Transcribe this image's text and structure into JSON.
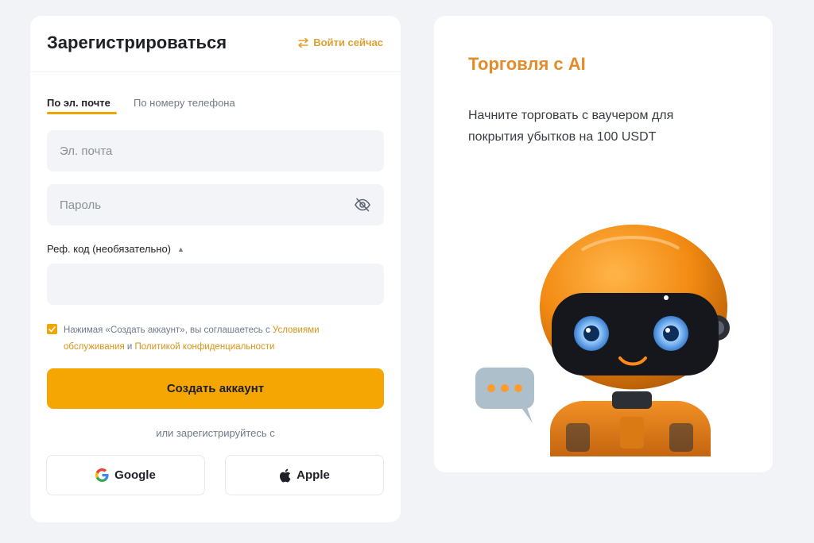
{
  "register": {
    "title": "Зарегистрироваться",
    "login_link": "Войти сейчас",
    "tabs": [
      {
        "label": "По эл. почте",
        "active": true
      },
      {
        "label": "По номеру телефона",
        "active": false
      }
    ],
    "email": {
      "placeholder": "Эл. почта",
      "value": ""
    },
    "password": {
      "placeholder": "Пароль",
      "value": ""
    },
    "referral": {
      "label": "Реф. код (необязательно)",
      "value": ""
    },
    "agreement": {
      "checked": true,
      "prefix": "Нажимая «Создать аккаунт», вы соглашаетесь с ",
      "terms_link": "Условиями обслуживания",
      "middle": " и ",
      "privacy_link": "Политикой конфиденциальности"
    },
    "submit_label": "Создать аккаунт",
    "or_text": "или зарегистрируйтесь с",
    "social": {
      "google_label": "Google",
      "apple_label": "Apple"
    }
  },
  "promo": {
    "title": "Торговля с AI",
    "text": "Начните торговать с ваучером для покрытия убытков на 100 USDT"
  },
  "icons": {
    "login_link": "swap-arrows-icon",
    "password_toggle": "eye-off-icon",
    "referral_toggle": "caret-up-icon",
    "checkbox": "check-icon",
    "google": "google-logo-icon",
    "apple": "apple-logo-icon"
  },
  "colors": {
    "accent": "#f5a602",
    "link": "#d69418",
    "promo_title": "#e48b2a",
    "page_bg": "#f1f3f6"
  }
}
